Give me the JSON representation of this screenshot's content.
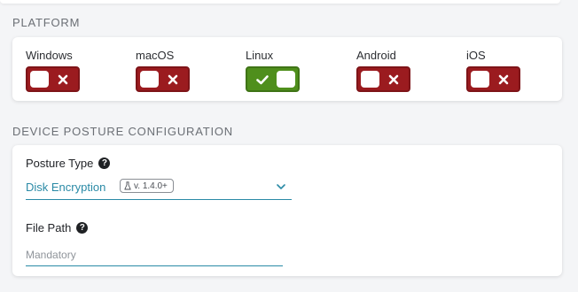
{
  "platform": {
    "heading": "PLATFORM",
    "items": [
      {
        "label": "Windows",
        "state": "off"
      },
      {
        "label": "macOS",
        "state": "off"
      },
      {
        "label": "Linux",
        "state": "on"
      },
      {
        "label": "Android",
        "state": "off"
      },
      {
        "label": "iOS",
        "state": "off"
      }
    ]
  },
  "posture": {
    "heading": "DEVICE POSTURE CONFIGURATION",
    "type_label": "Posture Type",
    "type_value": "Disk Encryption",
    "version_badge": "v. 1.4.0+",
    "file_path_label": "File Path",
    "file_path_placeholder": "Mandatory",
    "file_path_value": ""
  },
  "colors": {
    "toggle_off": "#9b1b1f",
    "toggle_on": "#4f8f1c",
    "accent": "#2a8aa6"
  },
  "icons": {
    "help": "question-circle-icon",
    "toggle_off_mark": "x-icon",
    "toggle_on_mark": "check-icon",
    "select_chevron": "chevron-down-icon",
    "version_badge_icon": "flask-icon"
  }
}
